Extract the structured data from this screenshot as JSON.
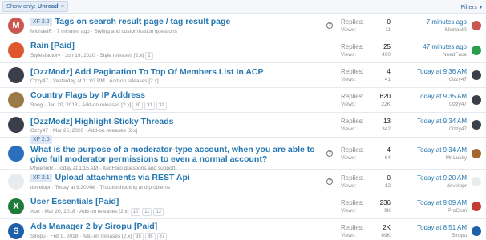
{
  "filterbar": {
    "chip_label": "Show only:",
    "chip_value": "Unread",
    "chip_close": "×",
    "filters_label": "Filters",
    "filters_caret": "▾"
  },
  "threads": [
    {
      "prefix": "XF 2.2",
      "title": "Tags on search result page / tag result page",
      "author": "MichaelR",
      "date": "7 minutes ago",
      "forum": "Styling and customization questions",
      "pages": [],
      "question": true,
      "replies": "0",
      "views": "11",
      "last_time": "7 minutes ago",
      "last_user": "MichaelR",
      "avatar_letter": "M",
      "avatar_color": "#c9574f",
      "small_color": "#c9574f"
    },
    {
      "prefix": "",
      "title": "Rain [Paid]",
      "author": "Stylesfactory",
      "date": "Jun 19, 2020",
      "forum": "Style releases [2.x]",
      "pages": [
        "2"
      ],
      "question": false,
      "replies": "25",
      "views": "490",
      "last_time": "47 minutes ago",
      "last_user": "NeedFace",
      "avatar_letter": "",
      "avatar_color": "#e0562d",
      "small_color": "#2a9d4b"
    },
    {
      "prefix": "",
      "title": "[OzzModz] Add Pagination To Top Of Members List In ACP",
      "author": "Ozzy47",
      "date": "Yesterday at 11:03 PM",
      "forum": "Add-on releases [2.x]",
      "pages": [],
      "question": false,
      "replies": "4",
      "views": "41",
      "last_time": "Today at 9:36 AM",
      "last_user": "Ozzy47",
      "avatar_letter": "",
      "avatar_color": "#3b3f4a",
      "small_color": "#3b3f4a"
    },
    {
      "prefix": "",
      "title": "Country Flags by IP Address",
      "author": "Snog",
      "date": "Jan 20, 2018",
      "forum": "Add-on releases [2.x]",
      "pages": [
        "30",
        "31",
        "32"
      ],
      "question": false,
      "replies": "620",
      "views": "22K",
      "last_time": "Today at 9:35 AM",
      "last_user": "Ozzy47",
      "avatar_letter": "",
      "avatar_color": "#9b7a4a",
      "small_color": "#3b3f4a"
    },
    {
      "prefix": "",
      "title": "[OzzModz] Highlight Sticky Threads",
      "author": "Ozzy47",
      "date": "Mar 25, 2020",
      "forum": "Add-on releases [2.x]",
      "pages": [],
      "question": false,
      "replies": "13",
      "views": "342",
      "last_time": "Today at 9:34 AM",
      "last_user": "Ozzy47",
      "avatar_letter": "",
      "avatar_color": "#3b3f4a",
      "small_color": "#3b3f4a"
    },
    {
      "prefix": "XF 2.0",
      "title": "What is the purpose of a moderator-type account, when you are able to give full moderator permissions to even a normal account?",
      "author": "PhoenixR",
      "date": "Today at 1:15 AM",
      "forum": "XenForo questions and support",
      "pages": [],
      "question": true,
      "replies": "4",
      "views": "64",
      "last_time": "Today at 9:34 AM",
      "last_user": "Mr Lucky",
      "avatar_letter": "",
      "avatar_color": "#2c6fbd",
      "small_color": "#a5672f"
    },
    {
      "prefix": "XF 2.1",
      "title": "Upload attachments via REST Api",
      "author": "developr",
      "date": "Today at 9:20 AM",
      "forum": "Troubleshooting and problems",
      "pages": [],
      "question": true,
      "replies": "0",
      "views": "12",
      "last_time": "Today at 9:20 AM",
      "last_user": "developr",
      "avatar_letter": "",
      "avatar_color": "#e9ecef",
      "small_color": "#e9ecef"
    },
    {
      "prefix": "",
      "title": "User Essentials [Paid]",
      "author": "Xon",
      "date": "Mar 20, 2018",
      "forum": "Add-on releases [2.x]",
      "pages": [
        "10",
        "11",
        "12"
      ],
      "question": false,
      "replies": "236",
      "views": "9K",
      "last_time": "Today at 9:09 AM",
      "last_user": "ProCom",
      "avatar_letter": "X",
      "avatar_color": "#1f7a3a",
      "small_color": "#c23b2e"
    },
    {
      "prefix": "",
      "title": "Ads Manager 2 by Siropu [Paid]",
      "author": "Siropu",
      "date": "Feb 9, 2018",
      "forum": "Add-on releases [2.x]",
      "pages": [
        "35",
        "36",
        "37"
      ],
      "question": false,
      "replies": "2K",
      "views": "69K",
      "last_time": "Today at 8:51 AM",
      "last_user": "Siropu",
      "avatar_letter": "S",
      "avatar_color": "#1d5fa8",
      "small_color": "#1d5fa8"
    }
  ],
  "labels": {
    "replies": "Replies:",
    "views": "Views:",
    "question_mark": "?",
    "sep": "·"
  }
}
